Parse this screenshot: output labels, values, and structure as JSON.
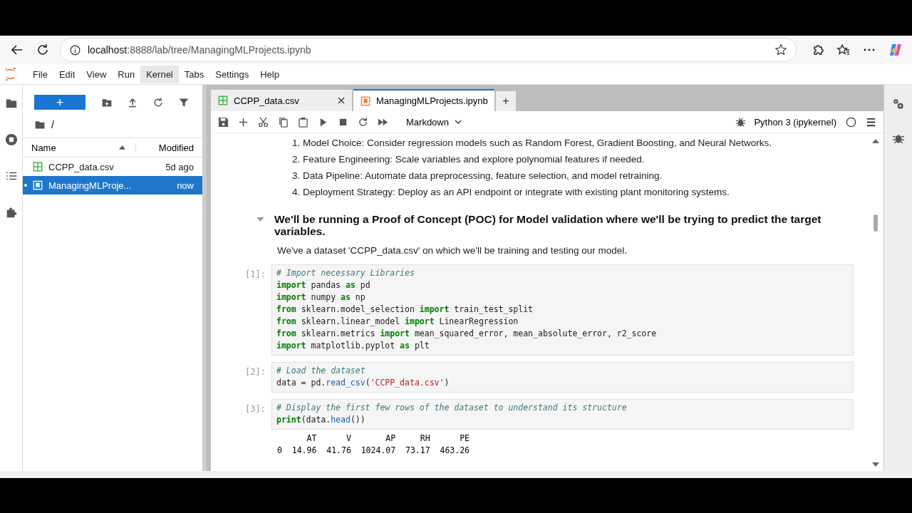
{
  "browser": {
    "url_host": "localhost",
    "url_path": ":8888/lab/tree/ManagingMLProjects.ipynb"
  },
  "menu": [
    {
      "label": "File",
      "selected": false
    },
    {
      "label": "Edit",
      "selected": false
    },
    {
      "label": "View",
      "selected": false
    },
    {
      "label": "Run",
      "selected": false
    },
    {
      "label": "Kernel",
      "selected": true
    },
    {
      "label": "Tabs",
      "selected": false
    },
    {
      "label": "Settings",
      "selected": false
    },
    {
      "label": "Help",
      "selected": false
    }
  ],
  "file_browser": {
    "new_button": "+",
    "path": "/",
    "columns": [
      "Name",
      "Modified"
    ],
    "files": [
      {
        "name": "CCPP_data.csv",
        "modified": "5d ago",
        "kind": "csv",
        "selected": false,
        "running": false
      },
      {
        "name": "ManagingMLProje...",
        "modified": "now",
        "kind": "notebook",
        "selected": true,
        "running": true
      }
    ]
  },
  "tabs": [
    {
      "label": "CCPP_data.csv",
      "kind": "csv",
      "selected": false
    },
    {
      "label": "ManagingMLProjects.ipynb",
      "kind": "notebook",
      "selected": true
    }
  ],
  "new_tab": "+",
  "toolbar": {
    "cell_type": "Markdown",
    "kernel": "Python 3 (ipykernel)"
  },
  "cells": [
    {
      "kind": "list",
      "items": [
        "1. Model Choice: Consider regression models such as Random Forest, Gradient Boosting, and Neural Networks.",
        "2. Feature Engineering: Scale variables and explore polynomial features if needed.",
        "3. Data Pipeline: Automate data preprocessing, feature selection, and model retraining.",
        "4. Deployment Strategy: Deploy as an API endpoint or integrate with existing plant monitoring systems."
      ]
    },
    {
      "kind": "heading",
      "text": "We'll be running a Proof of Concept (POC) for Model validation where we'll be trying to predict the target variables.",
      "expanded": true
    },
    {
      "kind": "paragraph",
      "text": "We've a dataset 'CCPP_data.csv' on which we'll be training and testing our model."
    },
    {
      "kind": "code",
      "prompt": "[1]:",
      "lines": [
        [
          {
            "text": "# Import necessary Libraries",
            "kind": "cm"
          }
        ],
        [
          {
            "text": "import",
            "kind": "kw"
          },
          {
            "text": " pandas ",
            "kind": "plain"
          },
          {
            "text": "as",
            "kind": "kw"
          },
          {
            "text": " pd",
            "kind": "plain"
          }
        ],
        [
          {
            "text": "import",
            "kind": "kw"
          },
          {
            "text": " numpy ",
            "kind": "plain"
          },
          {
            "text": "as",
            "kind": "kw"
          },
          {
            "text": " np",
            "kind": "plain"
          }
        ],
        [
          {
            "text": "from",
            "kind": "kw"
          },
          {
            "text": " sklearn.model_selection ",
            "kind": "plain"
          },
          {
            "text": "import",
            "kind": "kw"
          },
          {
            "text": " train_test_split",
            "kind": "plain"
          }
        ],
        [
          {
            "text": "from",
            "kind": "kw"
          },
          {
            "text": " sklearn.linear_model ",
            "kind": "plain"
          },
          {
            "text": "import",
            "kind": "kw"
          },
          {
            "text": " LinearRegression",
            "kind": "plain"
          }
        ],
        [
          {
            "text": "from",
            "kind": "kw"
          },
          {
            "text": " sklearn.metrics ",
            "kind": "plain"
          },
          {
            "text": "import",
            "kind": "kw"
          },
          {
            "text": " mean_squared_error, mean_absolute_error, r2_score",
            "kind": "plain"
          }
        ],
        [
          {
            "text": "import",
            "kind": "kw"
          },
          {
            "text": " matplotlib.pyplot ",
            "kind": "plain"
          },
          {
            "text": "as",
            "kind": "kw"
          },
          {
            "text": " plt",
            "kind": "plain"
          }
        ]
      ]
    },
    {
      "kind": "code",
      "prompt": "[2]:",
      "lines": [
        [
          {
            "text": "# Load the dataset",
            "kind": "cm"
          }
        ],
        [
          {
            "text": "data = pd.",
            "kind": "plain"
          },
          {
            "text": "read_csv",
            "kind": "fn"
          },
          {
            "text": "(",
            "kind": "plain"
          },
          {
            "text": "'CCPP_data.csv'",
            "kind": "str"
          },
          {
            "text": ")",
            "kind": "plain"
          }
        ]
      ]
    },
    {
      "kind": "code",
      "prompt": "[3]:",
      "lines": [
        [
          {
            "text": "# Display the first few rows of the dataset to understand its structure",
            "kind": "cm"
          }
        ],
        [
          {
            "text": "print",
            "kind": "kw"
          },
          {
            "text": "(data.",
            "kind": "plain"
          },
          {
            "text": "head",
            "kind": "fn"
          },
          {
            "text": "())",
            "kind": "plain"
          }
        ]
      ],
      "output": [
        "      AT      V       AP     RH      PE",
        "0  14.96  41.76  1024.07  73.17  463.26"
      ]
    }
  ]
}
